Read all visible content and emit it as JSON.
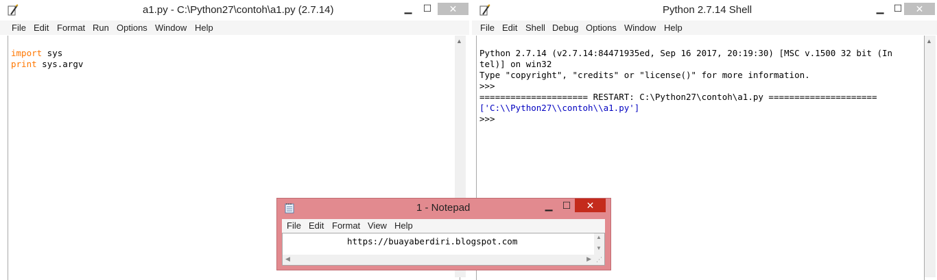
{
  "editor": {
    "title": "a1.py - C:\\Python27\\contoh\\a1.py (2.7.14)",
    "menu": [
      "File",
      "Edit",
      "Format",
      "Run",
      "Options",
      "Window",
      "Help"
    ],
    "code": [
      {
        "kw": "import",
        "rest": " sys"
      },
      {
        "kw": "print",
        "rest": " sys.argv"
      }
    ]
  },
  "shell": {
    "title": "Python 2.7.14 Shell",
    "menu": [
      "File",
      "Edit",
      "Shell",
      "Debug",
      "Options",
      "Window",
      "Help"
    ],
    "lines": [
      "Python 2.7.14 (v2.7.14:84471935ed, Sep 16 2017, 20:19:30) [MSC v.1500 32 bit (In",
      "tel)] on win32",
      "Type \"copyright\", \"credits\" or \"license()\" for more information.",
      ">>> ",
      "===================== RESTART: C:\\Python27\\contoh\\a1.py =====================",
      "['C:\\\\Python27\\\\contoh\\\\a1.py']",
      ">>> "
    ]
  },
  "notepad": {
    "title": "1 - Notepad",
    "menu": [
      "File",
      "Edit",
      "Format",
      "View",
      "Help"
    ],
    "text": "https://buayaberdiri.blogspot.com"
  },
  "window_controls": {
    "minimize": "▁",
    "maximize": "☐",
    "close": "✕"
  },
  "colors": {
    "keyword": "#ff7700",
    "output": "#0000c0",
    "notepad_frame": "#e28a8f",
    "close_active": "#c42b1c"
  }
}
